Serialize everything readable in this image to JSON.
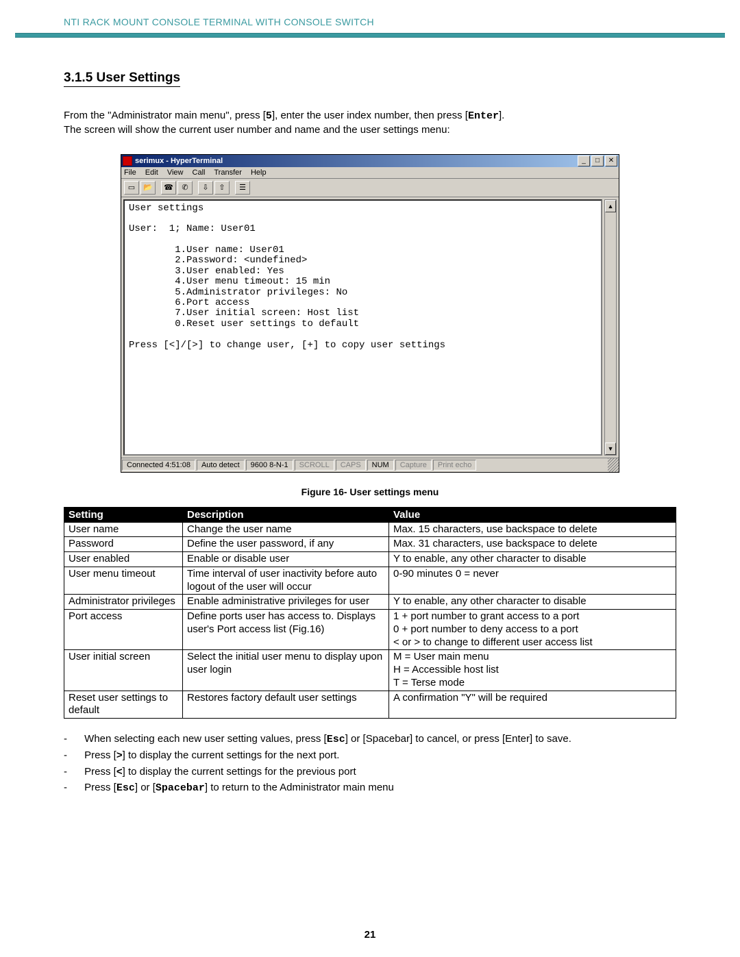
{
  "header": {
    "banner": "NTI RACK MOUNT CONSOLE TERMINAL WITH CONSOLE SWITCH"
  },
  "section": {
    "number_title": "3.1.5 User Settings",
    "intro_prefix": "From the \"Administrator main menu\", press [",
    "intro_key5": "5",
    "intro_mid": "], enter the user index number, then press [",
    "intro_enter": "Enter",
    "intro_suffix": "].",
    "intro_line2": "The screen will show the current user number and name and the user settings menu:"
  },
  "hyperterminal": {
    "title": "serimux - HyperTerminal",
    "menu": [
      "File",
      "Edit",
      "View",
      "Call",
      "Transfer",
      "Help"
    ],
    "toolbar_icons": [
      "new-file-icon",
      "open-file-icon",
      "connect-icon",
      "disconnect-icon",
      "send-icon",
      "receive-icon",
      "properties-icon"
    ],
    "terminal_text": "User settings\n\nUser:  1; Name: User01\n\n        1.User name: User01\n        2.Password: <undefined>\n        3.User enabled: Yes\n        4.User menu timeout: 15 min\n        5.Administrator privileges: No\n        6.Port access\n        7.User initial screen: Host list\n        0.Reset user settings to default\n\nPress [<]/[>] to change user, [+] to copy user settings",
    "status": {
      "connected": "Connected 4:51:08",
      "auto_detect": "Auto detect",
      "baud": "9600 8-N-1",
      "scroll": "SCROLL",
      "caps": "CAPS",
      "num": "NUM",
      "capture": "Capture",
      "print_echo": "Print echo"
    }
  },
  "figure_caption": "Figure 16- User settings menu",
  "table": {
    "headers": [
      "Setting",
      "Description",
      "Value"
    ],
    "rows": [
      {
        "setting": "User name",
        "desc": "Change the user name",
        "value": "Max. 15 characters, use backspace to delete"
      },
      {
        "setting": "Password",
        "desc": "Define the user password, if any",
        "value": "Max. 31 characters, use backspace to delete"
      },
      {
        "setting": "User enabled",
        "desc": "Enable or disable user",
        "value": "Y to enable, any other character to disable"
      },
      {
        "setting": "User menu timeout",
        "desc": "Time interval of user inactivity before auto logout of the user will occur",
        "value": "0-90 minutes   0 = never"
      },
      {
        "setting": "Administrator privileges",
        "desc": "Enable administrative privileges for user",
        "value": "Y to enable, any other character to disable"
      },
      {
        "setting": "Port access",
        "desc": "Define ports user has access to.  Displays user's Port access list (Fig.16)",
        "value": "1 + port number to grant access to a port\n0 + port number to deny access to a port\n< or > to change to different user access list"
      },
      {
        "setting": "User initial screen",
        "desc": "Select the initial user menu to display upon user login",
        "value": "M = User main menu\nH = Accessible host list\nT = Terse mode"
      },
      {
        "setting": "Reset user settings to default",
        "desc": "Restores factory default user settings",
        "value": "A confirmation \"Y\"  will be required"
      }
    ]
  },
  "notes": {
    "n1_a": "When selecting each new user setting values,  press [",
    "n1_esc": "Esc",
    "n1_b": "] or [Spacebar] to cancel,   or press [Enter] to save.",
    "n2_a": "Press [",
    "n2_gt": ">",
    "n2_b": "] to display the current settings for the next port.",
    "n3_a": "Press [",
    "n3_lt": "<",
    "n3_b": "] to display the current settings for the previous port",
    "n4_a": "Press [",
    "n4_esc": "Esc",
    "n4_b": "] or [",
    "n4_spc": "Spacebar",
    "n4_c": "] to return to the Administrator main menu"
  },
  "page_number": "21"
}
